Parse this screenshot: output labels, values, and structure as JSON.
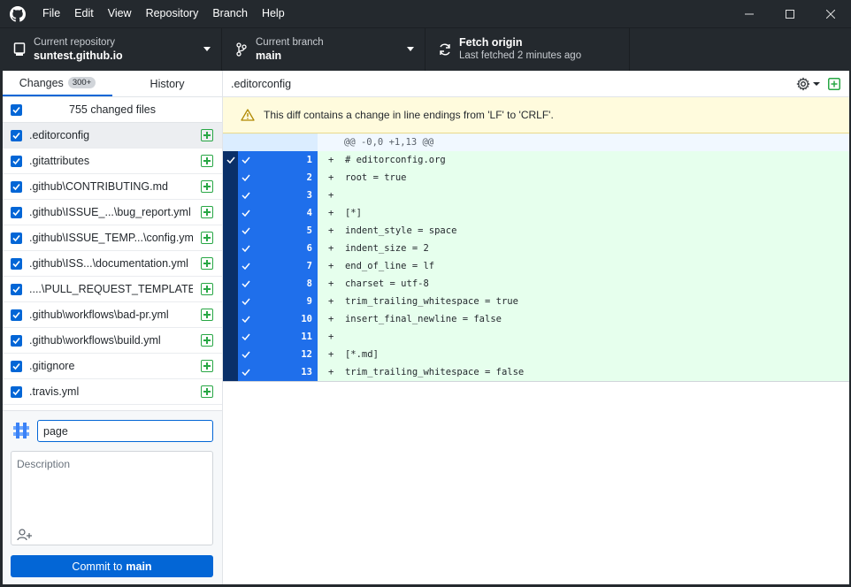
{
  "menu": [
    "File",
    "Edit",
    "View",
    "Repository",
    "Branch",
    "Help"
  ],
  "toolbar": {
    "repo_label": "Current repository",
    "repo_name": "suntest.github.io",
    "branch_label": "Current branch",
    "branch_name": "main",
    "fetch_title": "Fetch origin",
    "fetch_sub": "Last fetched 2 minutes ago"
  },
  "tabs": {
    "changes": "Changes",
    "changes_badge": "300+",
    "history": "History"
  },
  "changes": {
    "count_label": "755 changed files",
    "files": [
      ".editorconfig",
      ".gitattributes",
      ".github\\CONTRIBUTING.md",
      ".github\\ISSUE_...\\bug_report.yml",
      ".github\\ISSUE_TEMP...\\config.yml",
      ".github\\ISS...\\documentation.yml",
      "....\\PULL_REQUEST_TEMPLATE.md",
      ".github\\workflows\\bad-pr.yml",
      ".github\\workflows\\build.yml",
      ".gitignore",
      ".travis.yml"
    ]
  },
  "commit": {
    "summary_value": "page",
    "description_placeholder": "Description",
    "button_prefix": "Commit to",
    "button_branch": "main"
  },
  "diff": {
    "file_name": ".editorconfig",
    "warning": "This diff contains a change in line endings from 'LF' to 'CRLF'.",
    "hunk": "@@ -0,0 +1,13 @@",
    "lines": [
      {
        "num": "1",
        "code": "+  # editorconfig.org"
      },
      {
        "num": "2",
        "code": "+  root = true"
      },
      {
        "num": "3",
        "code": "+"
      },
      {
        "num": "4",
        "code": "+  [*]"
      },
      {
        "num": "5",
        "code": "+  indent_style = space"
      },
      {
        "num": "6",
        "code": "+  indent_size = 2"
      },
      {
        "num": "7",
        "code": "+  end_of_line = lf"
      },
      {
        "num": "8",
        "code": "+  charset = utf-8"
      },
      {
        "num": "9",
        "code": "+  trim_trailing_whitespace = true"
      },
      {
        "num": "10",
        "code": "+  insert_final_newline = false"
      },
      {
        "num": "11",
        "code": "+"
      },
      {
        "num": "12",
        "code": "+  [*.md]"
      },
      {
        "num": "13",
        "code": "+  trim_trailing_whitespace = false"
      }
    ]
  }
}
